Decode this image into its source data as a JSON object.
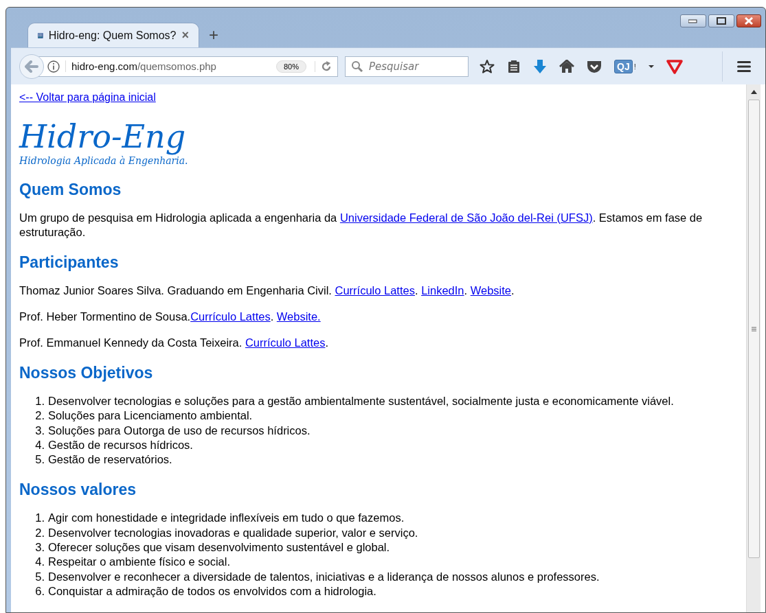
{
  "window": {
    "controls": [
      {
        "kind": "minimize"
      },
      {
        "kind": "maximize"
      },
      {
        "kind": "close"
      }
    ]
  },
  "tabs": [
    {
      "title": "Hidro-eng: Quem Somos?",
      "selected": true,
      "close": "×"
    }
  ],
  "new_tab": "+",
  "address_bar": {
    "domain": "hidro-eng.com",
    "path": "/quemsomos.php",
    "zoom": "80%"
  },
  "search": {
    "placeholder": "Pesquisar"
  },
  "toolbar": {
    "badge": "QJ",
    "badge_mark": "!"
  },
  "page": {
    "back_link": "<-- Voltar para página inicial",
    "site_title": "Hidro-Eng",
    "site_subtitle": "Hidrologia Aplicada à Engenharia.",
    "sections": [
      {
        "heading": "Quem Somos",
        "kind": "paragraphs",
        "paragraphs": [
          {
            "lead": "Um grupo de pesquisa em Hidrologia aplicada a engenharia da ",
            "links": [
              {
                "label": "Universidade Federal de São João del-Rei (UFSJ)",
                "trail": ". Estamos em fase de estruturação."
              }
            ]
          }
        ]
      },
      {
        "heading": "Participantes",
        "kind": "paragraphs",
        "paragraphs": [
          {
            "lead": "Thomaz Junior Soares Silva. Graduando em Engenharia Civil. ",
            "links": [
              {
                "label": "Currículo Lattes",
                "trail": ". "
              },
              {
                "label": "LinkedIn",
                "trail": ". "
              },
              {
                "label": "Website",
                "trail": "."
              }
            ]
          },
          {
            "lead": "Prof. Heber Tormentino de Sousa.",
            "links": [
              {
                "label": "Currículo Lattes",
                "trail": ". "
              },
              {
                "label": "Website."
              }
            ]
          },
          {
            "lead": "Prof. Emmanuel Kennedy da Costa Teixeira. ",
            "links": [
              {
                "label": "Currículo Lattes",
                "trail": "."
              }
            ]
          }
        ]
      },
      {
        "heading": "Nossos Objetivos",
        "kind": "ordered_list",
        "items": [
          {
            "number": "1.",
            "text": "Desenvolver tecnologias e soluções para a gestão ambientalmente sustentável, socialmente justa e economicamente viável."
          },
          {
            "number": "2.",
            "text": "Soluções para Licenciamento ambiental."
          },
          {
            "number": "3.",
            "text": "Soluções para Outorga de uso de recursos hídricos."
          },
          {
            "number": "4.",
            "text": "Gestão de recursos hídricos."
          },
          {
            "number": "5.",
            "text": "Gestão de reservatórios."
          }
        ]
      },
      {
        "heading": "Nossos valores",
        "kind": "ordered_list",
        "items": [
          {
            "number": "1.",
            "text": "Agir com honestidade e integridade inflexíveis em tudo o que fazemos."
          },
          {
            "number": "2.",
            "text": "Desenvolver tecnologias inovadoras e qualidade superior, valor e serviço."
          },
          {
            "number": "3.",
            "text": "Oferecer soluções que visam desenvolvimento sustentável e global."
          },
          {
            "number": "4.",
            "text": "Respeitar o ambiente físico e social."
          },
          {
            "number": "5.",
            "text": "Desenvolver e reconhecer a diversidade de talentos, iniciativas e a liderança de nossos alunos e professores."
          },
          {
            "number": "6.",
            "text": "Conquistar a admiração de todos os envolvidos com a hidrologia."
          }
        ]
      }
    ]
  }
}
